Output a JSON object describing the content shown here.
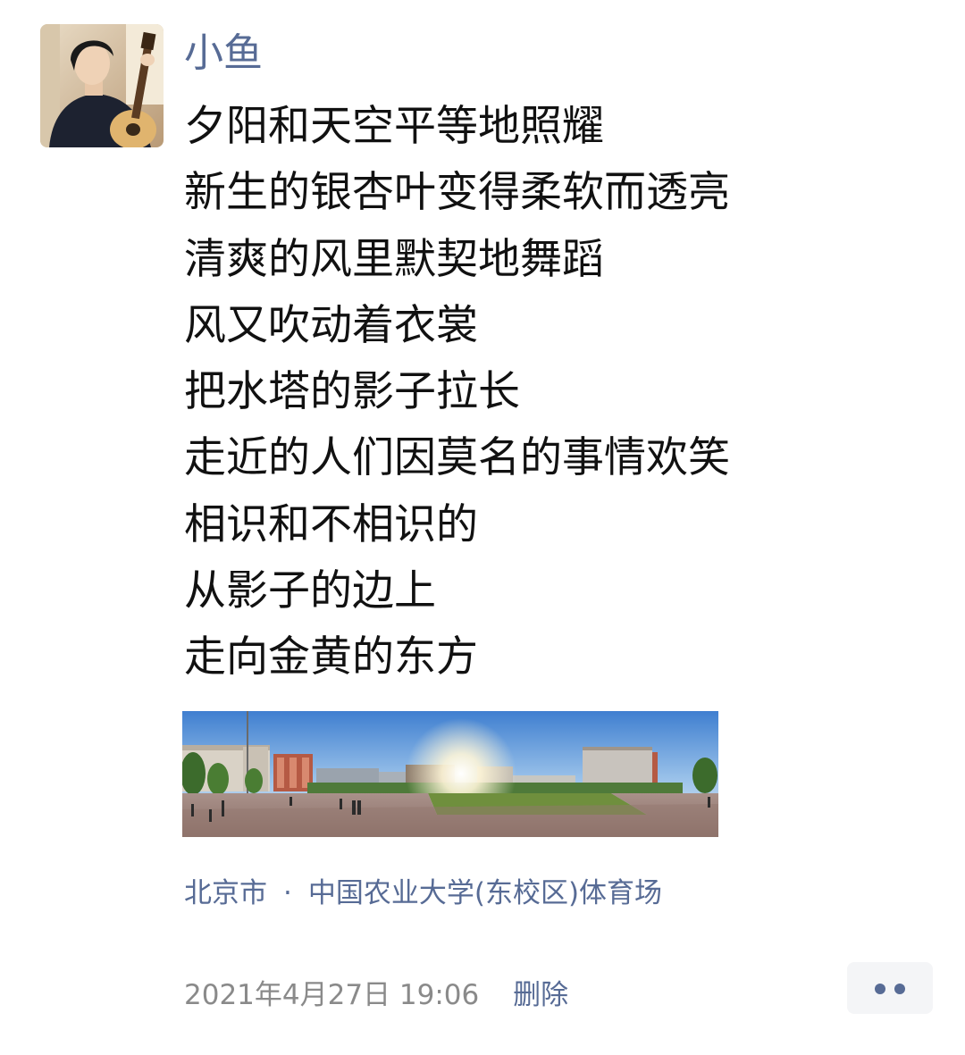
{
  "post": {
    "author": "小鱼",
    "lines": [
      "夕阳和天空平等地照耀",
      "新生的银杏叶变得柔软而透亮",
      "清爽的风里默契地舞蹈",
      "风又吹动着衣裳",
      "把水塔的影子拉长",
      "走近的人们因莫名的事情欢笑",
      "相识和不相识的",
      "从影子的边上",
      "走向金黄的东方"
    ],
    "location": {
      "city": "北京市",
      "separator": "·",
      "place": "中国农业大学(东校区)体育场"
    },
    "timestamp": "2021年4月27日 19:06",
    "delete_label": "删除"
  },
  "colors": {
    "link": "#576b95",
    "text": "#111111",
    "muted": "#8a8a8a",
    "more_button_bg": "#f4f5f7"
  },
  "icons": {
    "more": "more-dots-icon"
  }
}
